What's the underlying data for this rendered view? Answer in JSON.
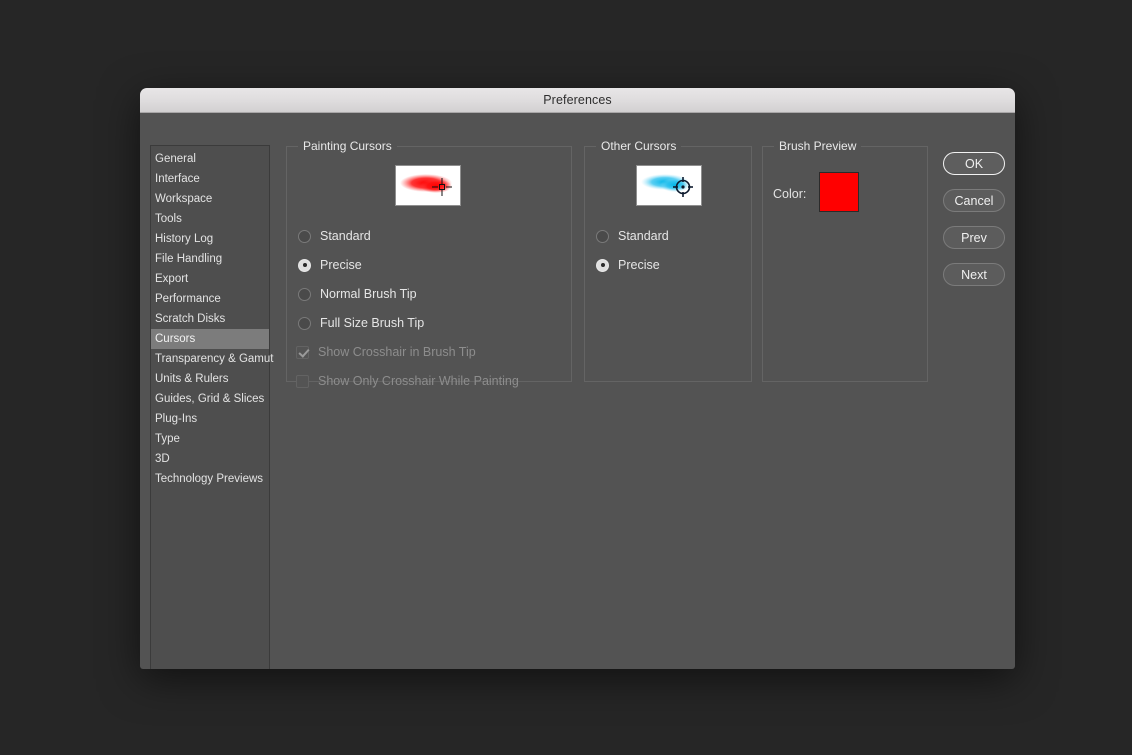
{
  "window": {
    "title": "Preferences"
  },
  "sidebar": {
    "items": [
      {
        "label": "General",
        "selected": false
      },
      {
        "label": "Interface",
        "selected": false
      },
      {
        "label": "Workspace",
        "selected": false
      },
      {
        "label": "Tools",
        "selected": false
      },
      {
        "label": "History Log",
        "selected": false
      },
      {
        "label": "File Handling",
        "selected": false
      },
      {
        "label": "Export",
        "selected": false
      },
      {
        "label": "Performance",
        "selected": false
      },
      {
        "label": "Scratch Disks",
        "selected": false
      },
      {
        "label": "Cursors",
        "selected": true
      },
      {
        "label": "Transparency & Gamut",
        "selected": false
      },
      {
        "label": "Units & Rulers",
        "selected": false
      },
      {
        "label": "Guides, Grid & Slices",
        "selected": false
      },
      {
        "label": "Plug-Ins",
        "selected": false
      },
      {
        "label": "Type",
        "selected": false
      },
      {
        "label": "3D",
        "selected": false
      },
      {
        "label": "Technology Previews",
        "selected": false
      }
    ]
  },
  "painting_cursors": {
    "title": "Painting Cursors",
    "preview_icon": "red-brush-stroke-precise-crosshair-preview",
    "options": [
      {
        "label": "Standard",
        "selected": false
      },
      {
        "label": "Precise",
        "selected": true
      },
      {
        "label": "Normal Brush Tip",
        "selected": false
      },
      {
        "label": "Full Size Brush Tip",
        "selected": false
      }
    ],
    "checkboxes": [
      {
        "label": "Show Crosshair in Brush Tip",
        "checked": true,
        "disabled": true
      },
      {
        "label": "Show Only Crosshair While Painting",
        "checked": false,
        "disabled": true
      }
    ]
  },
  "other_cursors": {
    "title": "Other Cursors",
    "preview_icon": "blue-brush-stroke-target-crosshair-preview",
    "options": [
      {
        "label": "Standard",
        "selected": false
      },
      {
        "label": "Precise",
        "selected": true
      }
    ]
  },
  "brush_preview": {
    "title": "Brush Preview",
    "color_label": "Color:",
    "color_value": "#FF0000"
  },
  "buttons": [
    {
      "label": "OK",
      "default": true
    },
    {
      "label": "Cancel",
      "default": false
    },
    {
      "label": "Prev",
      "default": false
    },
    {
      "label": "Next",
      "default": false
    }
  ],
  "colors": {
    "page_background": "#262626",
    "dialog_background": "#535353",
    "titlebar": "#dedcdd",
    "sidebar_background": "#4e4e4e",
    "sidebar_selected": "#7c7c7c",
    "text": "#e6e6e6",
    "disabled_text": "#8d8d8d",
    "accent_red": "#FF0000",
    "accent_cyan": "#22B9E8"
  }
}
